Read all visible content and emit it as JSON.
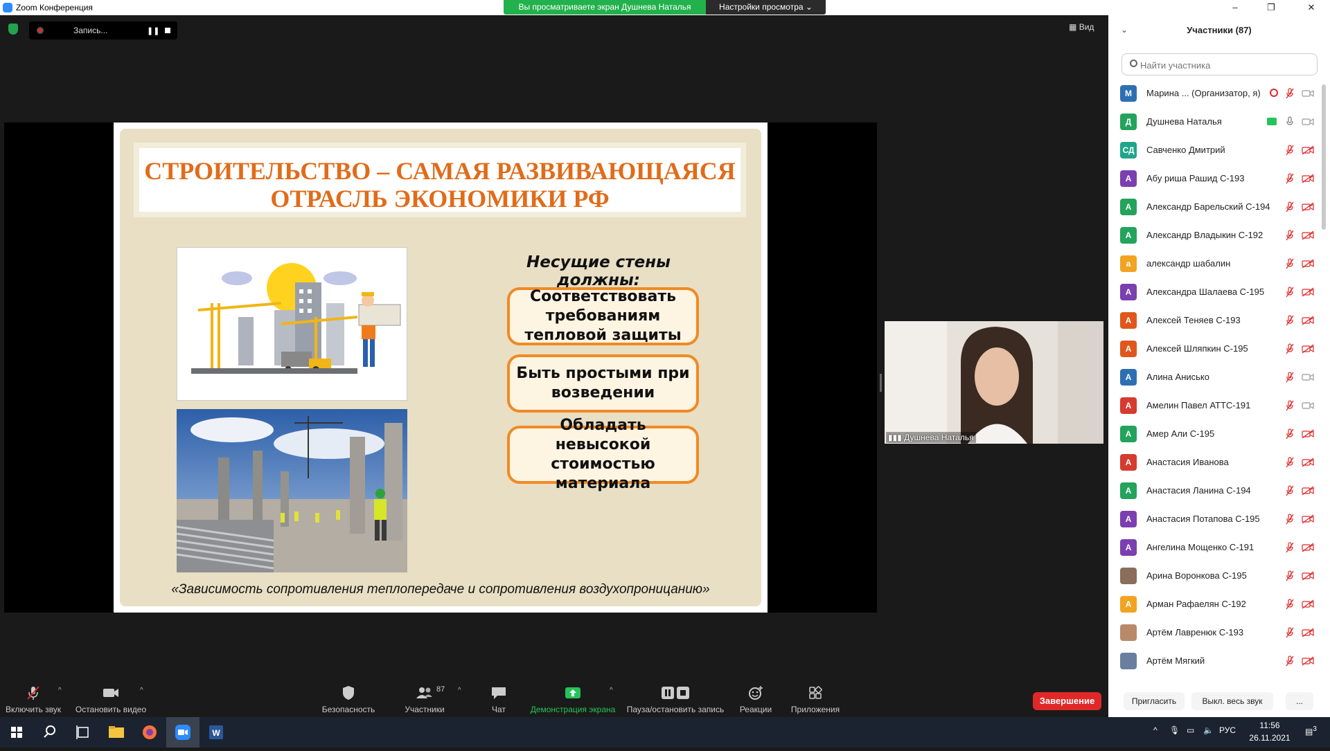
{
  "window": {
    "title": "Zoom Конференция",
    "minimize": "–",
    "maximize": "❐",
    "close": "✕"
  },
  "share_banner": {
    "viewing_text": "Вы просматриваете экран Душнева Наталья",
    "view_options": "Настройки просмотра ⌄"
  },
  "recording": {
    "label": "Запись..."
  },
  "view_button": "Вид",
  "slide": {
    "title_line1": "СТРОИТЕЛЬСТВО – САМАЯ РАЗВИВАЮЩАЯСЯ",
    "title_line2": "ОТРАСЛЬ ЭКОНОМИКИ РФ",
    "walls_title": "Несущие стены должны:",
    "requirements": [
      "Соответствовать требованиям тепловой защиты",
      "Быть простыми при возведении",
      "Обладать невысокой стоимостью материала"
    ],
    "footer": "«Зависимость сопротивления теплопередаче и сопротивления воздухопроницанию»"
  },
  "video": {
    "name": "Душнева Наталья"
  },
  "toolbar": {
    "unmute": "Включить звук",
    "stop_video": "Остановить видео",
    "security": "Безопасность",
    "participants": "Участники",
    "participants_count": "87",
    "chat": "Чат",
    "share_screen": "Демонстрация экрана",
    "pause_recording": "Пауза/остановить запись",
    "reactions": "Реакции",
    "apps": "Приложения",
    "end": "Завершение"
  },
  "colors": {
    "share_green": "#22b14c",
    "end_red": "#e02828",
    "accent_orange": "#e06c1a"
  },
  "panel": {
    "title": "Участники (87)",
    "search_placeholder": "Найти участника",
    "invite": "Пригласить",
    "mute_all": "Выкл. весь звук",
    "more": "..."
  },
  "participants": [
    {
      "initial": "М",
      "color": "#2d6fb3",
      "name": "Марина ...  (Организатор, я)"
    },
    {
      "initial": "Д",
      "color": "#23a35c",
      "name": "Душнева Наталья"
    },
    {
      "initial": "СД",
      "color": "#1fa58a",
      "name": "Савченко Дмитрий"
    },
    {
      "initial": "А",
      "color": "#7b3fb0",
      "name": "Абу риша Рашид С-193"
    },
    {
      "initial": "А",
      "color": "#23a35c",
      "name": "Александр Барельский С-194"
    },
    {
      "initial": "А",
      "color": "#23a35c",
      "name": "Александр Владыкин С-192"
    },
    {
      "initial": "а",
      "color": "#f0a422",
      "name": "александр шабалин"
    },
    {
      "initial": "А",
      "color": "#7b3fb0",
      "name": "Александра Шалаева С-195"
    },
    {
      "initial": "А",
      "color": "#e0571c",
      "name": "Алексей Теняев С-193"
    },
    {
      "initial": "А",
      "color": "#e0571c",
      "name": "Алексей Шляпкин С-195"
    },
    {
      "initial": "А",
      "color": "#2d6fb3",
      "name": "Алина Анисько"
    },
    {
      "initial": "А",
      "color": "#d63b2f",
      "name": "Амелин Павел АТТС-191"
    },
    {
      "initial": "А",
      "color": "#23a35c",
      "name": "Амер Али С-195"
    },
    {
      "initial": "А",
      "color": "#d63b2f",
      "name": "Анастасия Иванова"
    },
    {
      "initial": "А",
      "color": "#23a35c",
      "name": "Анастасия Ланина С-194"
    },
    {
      "initial": "А",
      "color": "#7b3fb0",
      "name": "Анастасия Потапова С-195"
    },
    {
      "initial": "А",
      "color": "#7b3fb0",
      "name": "Ангелина Мощенко С-191"
    },
    {
      "initial": "",
      "color": "#8a6d5a",
      "name": "Арина Воронкова С-195"
    },
    {
      "initial": "А",
      "color": "#f0a422",
      "name": "Арман Рафаелян С-192"
    },
    {
      "initial": "",
      "color": "#b88a6a",
      "name": "Артём Лавренюк С-193"
    },
    {
      "initial": "",
      "color": "#6a7fa0",
      "name": "Артём Мягкий"
    }
  ],
  "taskbar": {
    "lang": "РУС",
    "time": "11:56",
    "date": "26.11.2021",
    "notif_count": "3"
  }
}
